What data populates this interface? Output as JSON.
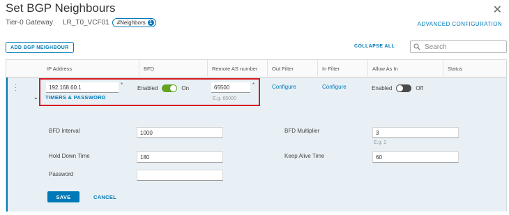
{
  "dialog": {
    "title": "Set BGP Neighbours",
    "gateway_label": "Tier-0 Gateway",
    "gateway_name": "LR_T0_VCF01",
    "neighbors_pill": "#Neighbors",
    "neighbors_count": "1",
    "advanced_config": "ADVANCED CONFIGURATION",
    "close_icon": "close-icon"
  },
  "toolbar": {
    "add_label": "ADD BGP NEIGHBOUR",
    "collapse_all": "COLLAPSE ALL",
    "search_placeholder": "Search"
  },
  "table": {
    "columns": [
      "IP Address",
      "BFD",
      "Remote AS number",
      "Out Filter",
      "In Filter",
      "Allow As In",
      "Status"
    ]
  },
  "row": {
    "ip_address": "192.168.60.1",
    "bfd_enabled_label": "Enabled",
    "bfd_state": "On",
    "remote_as": "65500",
    "remote_as_hint": "E.g. 65000",
    "out_filter": "Configure",
    "in_filter": "Configure",
    "allow_as_in_label": "Enabled",
    "allow_as_in_state": "Off",
    "required_marker": "*"
  },
  "timers": {
    "section_title": "TIMERS & PASSWORD",
    "bfd_interval_label": "BFD Interval",
    "bfd_interval_value": "1000",
    "bfd_multiplier_label": "BFD Multiplier",
    "bfd_multiplier_value": "3",
    "bfd_multiplier_hint": "E.g. 2",
    "hold_down_label": "Hold Down Time",
    "hold_down_value": "180",
    "keep_alive_label": "Keep Alive Time",
    "keep_alive_value": "60",
    "password_label": "Password",
    "password_value": ""
  },
  "actions": {
    "save": "SAVE",
    "cancel": "CANCEL"
  },
  "colors": {
    "accent": "#0079b8",
    "toggle_on": "#62a420",
    "toggle_off": "#4a4a4a",
    "highlight": "#d71920",
    "detail_bg": "#e8f0f5"
  }
}
